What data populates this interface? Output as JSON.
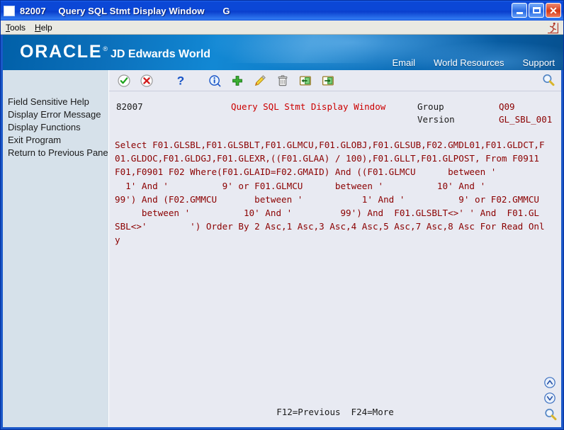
{
  "window": {
    "title_code": "82007",
    "title_text": "Query SQL Stmt Display Window",
    "title_suffix": "G",
    "minimize_label": "Minimize",
    "maximize_label": "Maximize",
    "close_label": "Close"
  },
  "menubar": {
    "items": [
      {
        "label": "Tools",
        "accel": "T"
      },
      {
        "label": "Help",
        "accel": "H"
      }
    ],
    "runner_icon": "running-man-icon"
  },
  "banner": {
    "logo": "ORACLE",
    "logo_reg": "®",
    "product": "JD Edwards World",
    "links": [
      {
        "label": "Email"
      },
      {
        "label": "World Resources"
      },
      {
        "label": "Support"
      }
    ]
  },
  "toolbar": {
    "buttons": [
      {
        "name": "accept-button",
        "icon": "green-check-circle-icon"
      },
      {
        "name": "cancel-button",
        "icon": "red-x-circle-icon"
      },
      {
        "name": "help-button",
        "icon": "question-mark-icon"
      },
      {
        "name": "info-button",
        "icon": "info-circle-icon"
      },
      {
        "name": "add-button",
        "icon": "green-plus-icon"
      },
      {
        "name": "edit-button",
        "icon": "pencil-icon"
      },
      {
        "name": "delete-button",
        "icon": "trash-icon"
      },
      {
        "name": "previous-panel-button",
        "icon": "exit-left-icon"
      },
      {
        "name": "exit-program-button",
        "icon": "exit-right-icon"
      }
    ],
    "search_icon": "magnifier-icon"
  },
  "sidebar": {
    "items": [
      {
        "label": "Field Sensitive Help"
      },
      {
        "label": "Display Error Message"
      },
      {
        "label": "Display Functions"
      },
      {
        "label": "Exit Program"
      },
      {
        "label": "Return to Previous Panel"
      }
    ]
  },
  "screen": {
    "program_code": "82007",
    "screen_title": "Query SQL Stmt Display Window",
    "group_label": "Group",
    "group_value": "Q09",
    "version_label": "Version",
    "version_value": "GL_SBL_001",
    "sql_text": "Select F01.GLSBL,F01.GLSBLT,F01.GLMCU,F01.GLOBJ,F01.GLSUB,F02.GMDL01,F01.GLDCT,F\n01.GLDOC,F01.GLDGJ,F01.GLEXR,((F01.GLAA) / 100),F01.GLLT,F01.GLPOST, From F0911\nF01,F0901 F02 Where(F01.GLAID=F02.GMAID) And ((F01.GLMCU      between '\n  1' And '          9' or F01.GLMCU      between '          10' And '\n99') And (F02.GMMCU       between '           1' And '          9' or F02.GMMCU\n     between '          10' And '         99') And  F01.GLSBLT<>' ' And  F01.GL\nSBL<>'        ') Order By 2 Asc,1 Asc,3 Asc,4 Asc,5 Asc,7 Asc,8 Asc For Read Onl\ny",
    "function_keys": "F12=Previous  F24=More",
    "nav_icons": [
      {
        "name": "page-up-button",
        "icon": "chevron-up-circle-icon"
      },
      {
        "name": "page-down-button",
        "icon": "chevron-down-circle-icon"
      },
      {
        "name": "screen-search-button",
        "icon": "magnifier-icon"
      }
    ]
  },
  "colors": {
    "title_bar": "#0b47d6",
    "banner_blue": "#0e79c4",
    "sidebar_bg": "#d6e1ea",
    "content_bg": "#e8eaf2",
    "sql_red": "#8b0000",
    "title_red": "#cc0000",
    "window_border": "#1b58c8"
  }
}
